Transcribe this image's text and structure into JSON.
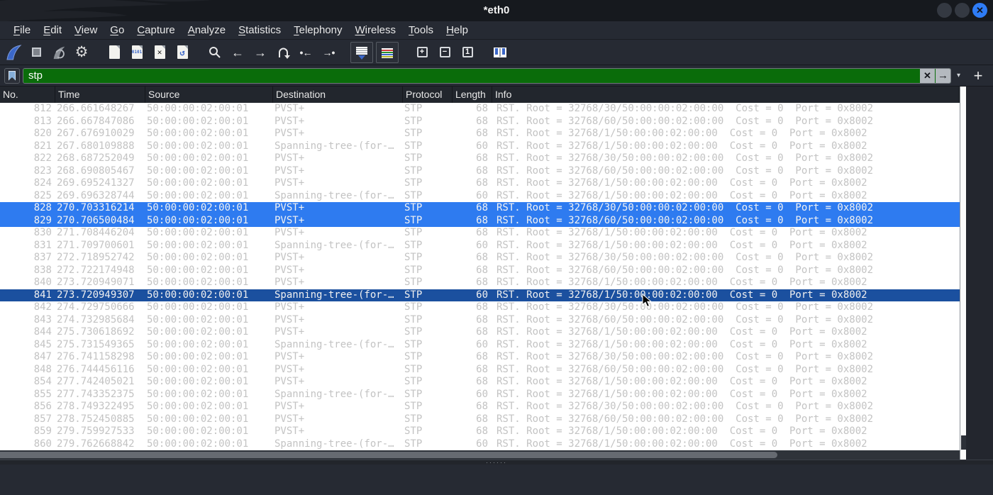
{
  "window": {
    "title": "*eth0"
  },
  "menu": {
    "items": [
      "File",
      "Edit",
      "View",
      "Go",
      "Capture",
      "Analyze",
      "Statistics",
      "Telephony",
      "Wireless",
      "Tools",
      "Help"
    ]
  },
  "toolbar": {
    "buttons": [
      "start-capture",
      "stop-capture",
      "restart-capture",
      "capture-options",
      "open-file",
      "save-file",
      "close-file",
      "reload-file",
      "find-packet",
      "go-back",
      "go-forward",
      "go-to-packet",
      "go-first-packet",
      "go-last-packet",
      "auto-scroll-toggle",
      "colorize-toggle",
      "zoom-in",
      "zoom-out",
      "normal-size",
      "resize-columns"
    ],
    "glyphs": {
      "save_bits": "0101",
      "close_x": "✕",
      "reload": "↺",
      "back": "←",
      "forward": "→",
      "first": "•←",
      "last": "→•",
      "zoom_in": "+",
      "zoom_out": "−",
      "normal": "1"
    }
  },
  "filter": {
    "value": "stp",
    "clear": "✕",
    "apply": "→",
    "dropdown": "▾",
    "add": "+"
  },
  "table": {
    "columns": [
      "No.",
      "Time",
      "Source",
      "Destination",
      "Protocol",
      "Length",
      "Info"
    ],
    "rows": [
      {
        "no": "812",
        "time": "266.661648267",
        "source": "50:00:00:02:00:01",
        "destination": "PVST+",
        "protocol": "STP",
        "length": "68",
        "info": "RST. Root = 32768/30/50:00:00:02:00:00  Cost = 0  Port = 0x8002",
        "state": "normal"
      },
      {
        "no": "813",
        "time": "266.667847086",
        "source": "50:00:00:02:00:01",
        "destination": "PVST+",
        "protocol": "STP",
        "length": "68",
        "info": "RST. Root = 32768/60/50:00:00:02:00:00  Cost = 0  Port = 0x8002",
        "state": "normal"
      },
      {
        "no": "820",
        "time": "267.676910029",
        "source": "50:00:00:02:00:01",
        "destination": "PVST+",
        "protocol": "STP",
        "length": "68",
        "info": "RST. Root = 32768/1/50:00:00:02:00:00  Cost = 0  Port = 0x8002",
        "state": "normal"
      },
      {
        "no": "821",
        "time": "267.680109888",
        "source": "50:00:00:02:00:01",
        "destination": "Spanning-tree-(for-…",
        "protocol": "STP",
        "length": "60",
        "info": "RST. Root = 32768/1/50:00:00:02:00:00  Cost = 0  Port = 0x8002",
        "state": "normal"
      },
      {
        "no": "822",
        "time": "268.687252049",
        "source": "50:00:00:02:00:01",
        "destination": "PVST+",
        "protocol": "STP",
        "length": "68",
        "info": "RST. Root = 32768/30/50:00:00:02:00:00  Cost = 0  Port = 0x8002",
        "state": "normal"
      },
      {
        "no": "823",
        "time": "268.690805467",
        "source": "50:00:00:02:00:01",
        "destination": "PVST+",
        "protocol": "STP",
        "length": "68",
        "info": "RST. Root = 32768/60/50:00:00:02:00:00  Cost = 0  Port = 0x8002",
        "state": "normal"
      },
      {
        "no": "824",
        "time": "269.695241327",
        "source": "50:00:00:02:00:01",
        "destination": "PVST+",
        "protocol": "STP",
        "length": "68",
        "info": "RST. Root = 32768/1/50:00:00:02:00:00  Cost = 0  Port = 0x8002",
        "state": "normal"
      },
      {
        "no": "825",
        "time": "269.696328744",
        "source": "50:00:00:02:00:01",
        "destination": "Spanning-tree-(for-…",
        "protocol": "STP",
        "length": "60",
        "info": "RST. Root = 32768/1/50:00:00:02:00:00  Cost = 0  Port = 0x8002",
        "state": "normal"
      },
      {
        "no": "828",
        "time": "270.703316214",
        "source": "50:00:00:02:00:01",
        "destination": "PVST+",
        "protocol": "STP",
        "length": "68",
        "info": "RST. Root = 32768/30/50:00:00:02:00:00  Cost = 0  Port = 0x8002",
        "state": "selected"
      },
      {
        "no": "829",
        "time": "270.706500484",
        "source": "50:00:00:02:00:01",
        "destination": "PVST+",
        "protocol": "STP",
        "length": "68",
        "info": "RST. Root = 32768/60/50:00:00:02:00:00  Cost = 0  Port = 0x8002",
        "state": "selected"
      },
      {
        "no": "830",
        "time": "271.708446204",
        "source": "50:00:00:02:00:01",
        "destination": "PVST+",
        "protocol": "STP",
        "length": "68",
        "info": "RST. Root = 32768/1/50:00:00:02:00:00  Cost = 0  Port = 0x8002",
        "state": "normal"
      },
      {
        "no": "831",
        "time": "271.709700601",
        "source": "50:00:00:02:00:01",
        "destination": "Spanning-tree-(for-…",
        "protocol": "STP",
        "length": "60",
        "info": "RST. Root = 32768/1/50:00:00:02:00:00  Cost = 0  Port = 0x8002",
        "state": "normal"
      },
      {
        "no": "837",
        "time": "272.718952742",
        "source": "50:00:00:02:00:01",
        "destination": "PVST+",
        "protocol": "STP",
        "length": "68",
        "info": "RST. Root = 32768/30/50:00:00:02:00:00  Cost = 0  Port = 0x8002",
        "state": "normal"
      },
      {
        "no": "838",
        "time": "272.722174948",
        "source": "50:00:00:02:00:01",
        "destination": "PVST+",
        "protocol": "STP",
        "length": "68",
        "info": "RST. Root = 32768/60/50:00:00:02:00:00  Cost = 0  Port = 0x8002",
        "state": "normal"
      },
      {
        "no": "840",
        "time": "273.720949071",
        "source": "50:00:00:02:00:01",
        "destination": "PVST+",
        "protocol": "STP",
        "length": "68",
        "info": "RST. Root = 32768/1/50:00:00:02:00:00  Cost = 0  Port = 0x8002",
        "state": "normal"
      },
      {
        "no": "841",
        "time": "273.720949307",
        "source": "50:00:00:02:00:01",
        "destination": "Spanning-tree-(for-…",
        "protocol": "STP",
        "length": "60",
        "info": "RST. Root = 32768/1/50:00:00:02:00:00  Cost = 0  Port = 0x8002",
        "state": "focused"
      },
      {
        "no": "842",
        "time": "274.729750666",
        "source": "50:00:00:02:00:01",
        "destination": "PVST+",
        "protocol": "STP",
        "length": "68",
        "info": "RST. Root = 32768/30/50:00:00:02:00:00  Cost = 0  Port = 0x8002",
        "state": "normal"
      },
      {
        "no": "843",
        "time": "274.732985684",
        "source": "50:00:00:02:00:01",
        "destination": "PVST+",
        "protocol": "STP",
        "length": "68",
        "info": "RST. Root = 32768/60/50:00:00:02:00:00  Cost = 0  Port = 0x8002",
        "state": "normal"
      },
      {
        "no": "844",
        "time": "275.730618692",
        "source": "50:00:00:02:00:01",
        "destination": "PVST+",
        "protocol": "STP",
        "length": "68",
        "info": "RST. Root = 32768/1/50:00:00:02:00:00  Cost = 0  Port = 0x8002",
        "state": "normal"
      },
      {
        "no": "845",
        "time": "275.731549365",
        "source": "50:00:00:02:00:01",
        "destination": "Spanning-tree-(for-…",
        "protocol": "STP",
        "length": "60",
        "info": "RST. Root = 32768/1/50:00:00:02:00:00  Cost = 0  Port = 0x8002",
        "state": "normal"
      },
      {
        "no": "847",
        "time": "276.741158298",
        "source": "50:00:00:02:00:01",
        "destination": "PVST+",
        "protocol": "STP",
        "length": "68",
        "info": "RST. Root = 32768/30/50:00:00:02:00:00  Cost = 0  Port = 0x8002",
        "state": "normal"
      },
      {
        "no": "848",
        "time": "276.744456116",
        "source": "50:00:00:02:00:01",
        "destination": "PVST+",
        "protocol": "STP",
        "length": "68",
        "info": "RST. Root = 32768/60/50:00:00:02:00:00  Cost = 0  Port = 0x8002",
        "state": "normal"
      },
      {
        "no": "854",
        "time": "277.742405021",
        "source": "50:00:00:02:00:01",
        "destination": "PVST+",
        "protocol": "STP",
        "length": "68",
        "info": "RST. Root = 32768/1/50:00:00:02:00:00  Cost = 0  Port = 0x8002",
        "state": "normal"
      },
      {
        "no": "855",
        "time": "277.743352375",
        "source": "50:00:00:02:00:01",
        "destination": "Spanning-tree-(for-…",
        "protocol": "STP",
        "length": "60",
        "info": "RST. Root = 32768/1/50:00:00:02:00:00  Cost = 0  Port = 0x8002",
        "state": "normal"
      },
      {
        "no": "856",
        "time": "278.749322495",
        "source": "50:00:00:02:00:01",
        "destination": "PVST+",
        "protocol": "STP",
        "length": "68",
        "info": "RST. Root = 32768/30/50:00:00:02:00:00  Cost = 0  Port = 0x8002",
        "state": "normal"
      },
      {
        "no": "857",
        "time": "278.752450885",
        "source": "50:00:00:02:00:01",
        "destination": "PVST+",
        "protocol": "STP",
        "length": "68",
        "info": "RST. Root = 32768/60/50:00:00:02:00:00  Cost = 0  Port = 0x8002",
        "state": "normal"
      },
      {
        "no": "859",
        "time": "279.759927533",
        "source": "50:00:00:02:00:01",
        "destination": "PVST+",
        "protocol": "STP",
        "length": "68",
        "info": "RST. Root = 32768/1/50:00:00:02:00:00  Cost = 0  Port = 0x8002",
        "state": "normal"
      },
      {
        "no": "860",
        "time": "279.762668842",
        "source": "50:00:00:02:00:01",
        "destination": "Spanning-tree-(for-…",
        "protocol": "STP",
        "length": "60",
        "info": "RST. Root = 32768/1/50:00:00:02:00:00  Cost = 0  Port = 0x8002",
        "state": "normal"
      }
    ]
  },
  "colors": {
    "filter_valid_bg": "#0a6c0a",
    "selected_row_bg": "#2e7bf0",
    "focused_row_bg": "#1b509f",
    "row_text": "#c3c3c3",
    "accent_blue": "#3b67c9"
  }
}
